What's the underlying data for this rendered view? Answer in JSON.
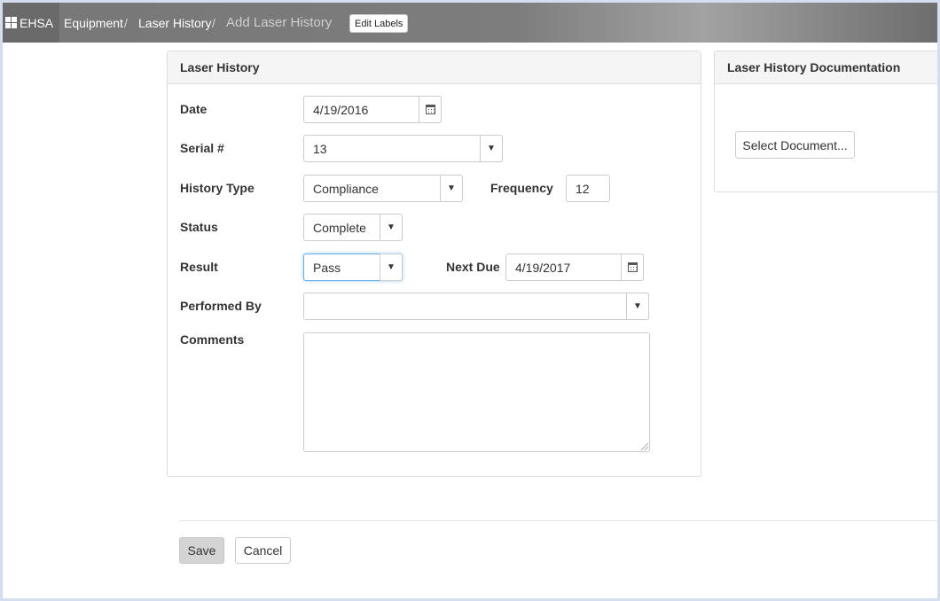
{
  "breadcrumb": {
    "brand": "EHSA",
    "items": [
      "Equipment",
      "Laser History"
    ],
    "current": "Add Laser History",
    "separator": "/"
  },
  "edit_labels_button": "Edit Labels",
  "form_panel": {
    "title": "Laser History",
    "date": {
      "label": "Date",
      "value": "4/19/2016"
    },
    "serial": {
      "label": "Serial #",
      "value": "13"
    },
    "history_type": {
      "label": "History Type",
      "value": "Compliance"
    },
    "frequency": {
      "label": "Frequency",
      "value": "12"
    },
    "status": {
      "label": "Status",
      "value": "Complete"
    },
    "result": {
      "label": "Result",
      "value": "Pass"
    },
    "next_due": {
      "label": "Next Due",
      "value": "4/19/2017"
    },
    "performed_by": {
      "label": "Performed By",
      "value": ""
    },
    "comments": {
      "label": "Comments",
      "value": ""
    }
  },
  "doc_panel": {
    "title": "Laser History Documentation",
    "select_button": "Select Document..."
  },
  "actions": {
    "save": "Save",
    "cancel": "Cancel"
  },
  "icons": {
    "dropdown": "caret-down-icon",
    "calendar": "calendar-icon",
    "brand": "grid-icon"
  },
  "colors": {
    "topbar": "#7a7a7a",
    "focus_border": "#66afe9",
    "panel_heading_bg": "#f5f5f5"
  }
}
